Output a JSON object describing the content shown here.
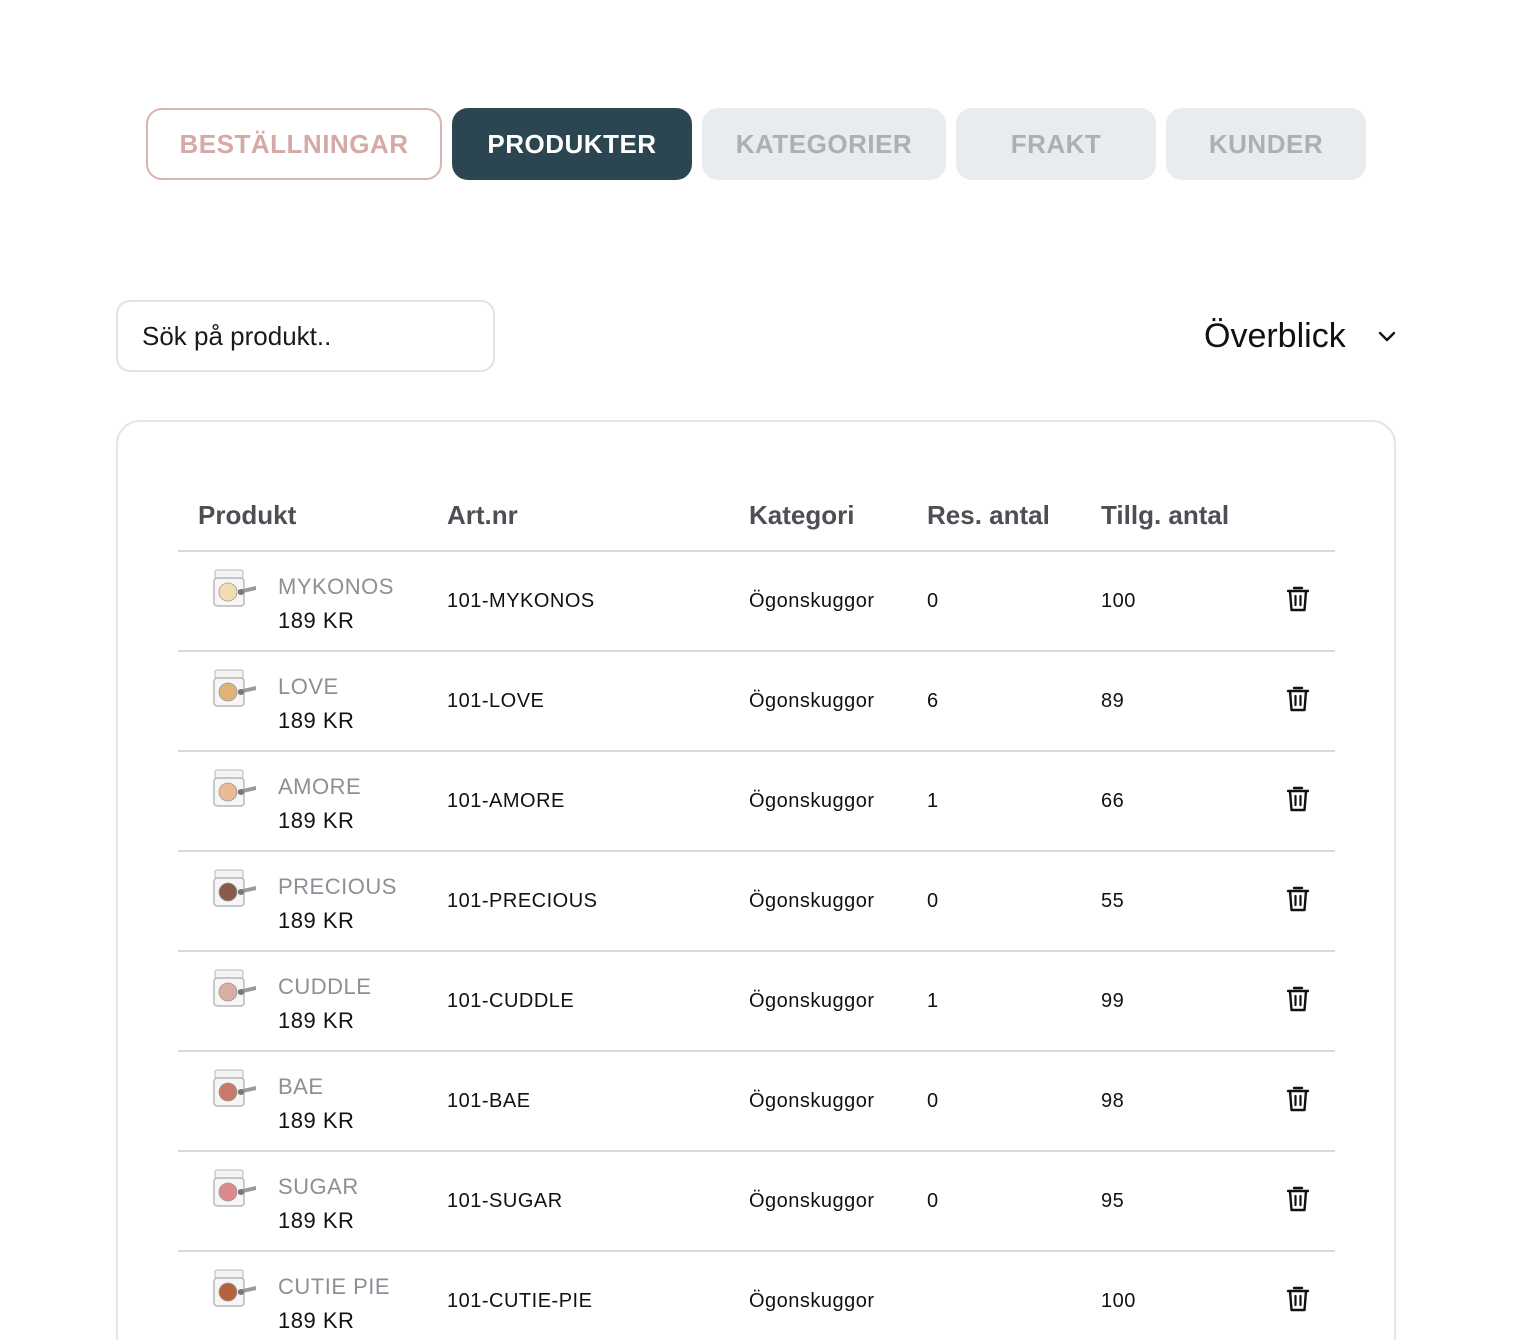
{
  "tabs": {
    "orders": "BESTÄLLNINGAR",
    "products": "PRODUKTER",
    "categories": "KATEGORIER",
    "shipping": "FRAKT",
    "customers": "KUNDER"
  },
  "search": {
    "placeholder": "Sök på produkt..",
    "value": ""
  },
  "view_select": {
    "selected": "Överblick",
    "icon": "chevron-down-icon"
  },
  "table": {
    "headers": [
      "Produkt",
      "Art.nr",
      "Kategori",
      "Res. antal",
      "Tillg. antal"
    ],
    "rows": [
      {
        "name": "MYKONOS",
        "price": "189 KR",
        "artnr": "101-MYKONOS",
        "category": "Ögonskuggor",
        "reserved": "0",
        "available": "100",
        "swatch": "#f1ddb0"
      },
      {
        "name": "LOVE",
        "price": "189 KR",
        "artnr": "101-LOVE",
        "category": "Ögonskuggor",
        "reserved": "6",
        "available": "89",
        "swatch": "#e0b27a"
      },
      {
        "name": "AMORE",
        "price": "189 KR",
        "artnr": "101-AMORE",
        "category": "Ögonskuggor",
        "reserved": "1",
        "available": "66",
        "swatch": "#eab996"
      },
      {
        "name": "PRECIOUS",
        "price": "189 KR",
        "artnr": "101-PRECIOUS",
        "category": "Ögonskuggor",
        "reserved": "0",
        "available": "55",
        "swatch": "#8a5a4c"
      },
      {
        "name": "CUDDLE",
        "price": "189 KR",
        "artnr": "101-CUDDLE",
        "category": "Ögonskuggor",
        "reserved": "1",
        "available": "99",
        "swatch": "#d9aea4"
      },
      {
        "name": "BAE",
        "price": "189 KR",
        "artnr": "101-BAE",
        "category": "Ögonskuggor",
        "reserved": "0",
        "available": "98",
        "swatch": "#c97968"
      },
      {
        "name": "SUGAR",
        "price": "189 KR",
        "artnr": "101-SUGAR",
        "category": "Ögonskuggor",
        "reserved": "0",
        "available": "95",
        "swatch": "#de8a8c"
      },
      {
        "name": "CUTIE PIE",
        "price": "189 KR",
        "artnr": "101-CUTIE-PIE",
        "category": "Ögonskuggor",
        "reserved": "",
        "available": "100",
        "swatch": "#b5623e"
      }
    ]
  },
  "colors": {
    "accent_dark": "#2b4650",
    "accent_pink": "#d4a9a6",
    "tab_inactive_bg": "#e8ecef"
  }
}
